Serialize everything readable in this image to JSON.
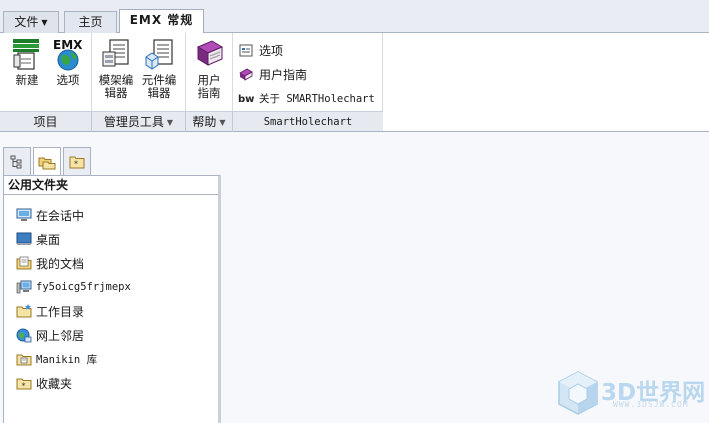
{
  "tabs": {
    "file": "文件",
    "home": "主页",
    "emx": "EMX 常规"
  },
  "ribbon": {
    "new_label": "新建",
    "options_label": "选项",
    "model_editor_label": "模架编辑器",
    "component_editor_label": "元件编辑器",
    "user_guide_label": "用户指南",
    "smart_items": [
      {
        "label": "选项"
      },
      {
        "label": "用户指南"
      },
      {
        "label": "关于 SMARTHolechart"
      }
    ],
    "groups": {
      "project": "项目",
      "admin_tools": "管理员工具",
      "help": "帮助",
      "smartholechart": "SmartHolechart"
    }
  },
  "navigator": {
    "panel_title": "公用文件夹",
    "folders": [
      {
        "label": "在会话中"
      },
      {
        "label": "桌面"
      },
      {
        "label": "我的文档"
      },
      {
        "label": "fy5oicg5frjmepx"
      },
      {
        "label": "工作目录"
      },
      {
        "label": "网上邻居"
      },
      {
        "label": "Manikin 库"
      },
      {
        "label": "收藏夹"
      }
    ]
  },
  "watermark": {
    "brand": "3D世界网",
    "url": "WWW.3DSJW.COM"
  },
  "colors": {
    "accent_blue": "#2f6fb7",
    "tab_border": "#aab3c3",
    "watermark": "#b9d7ee"
  }
}
